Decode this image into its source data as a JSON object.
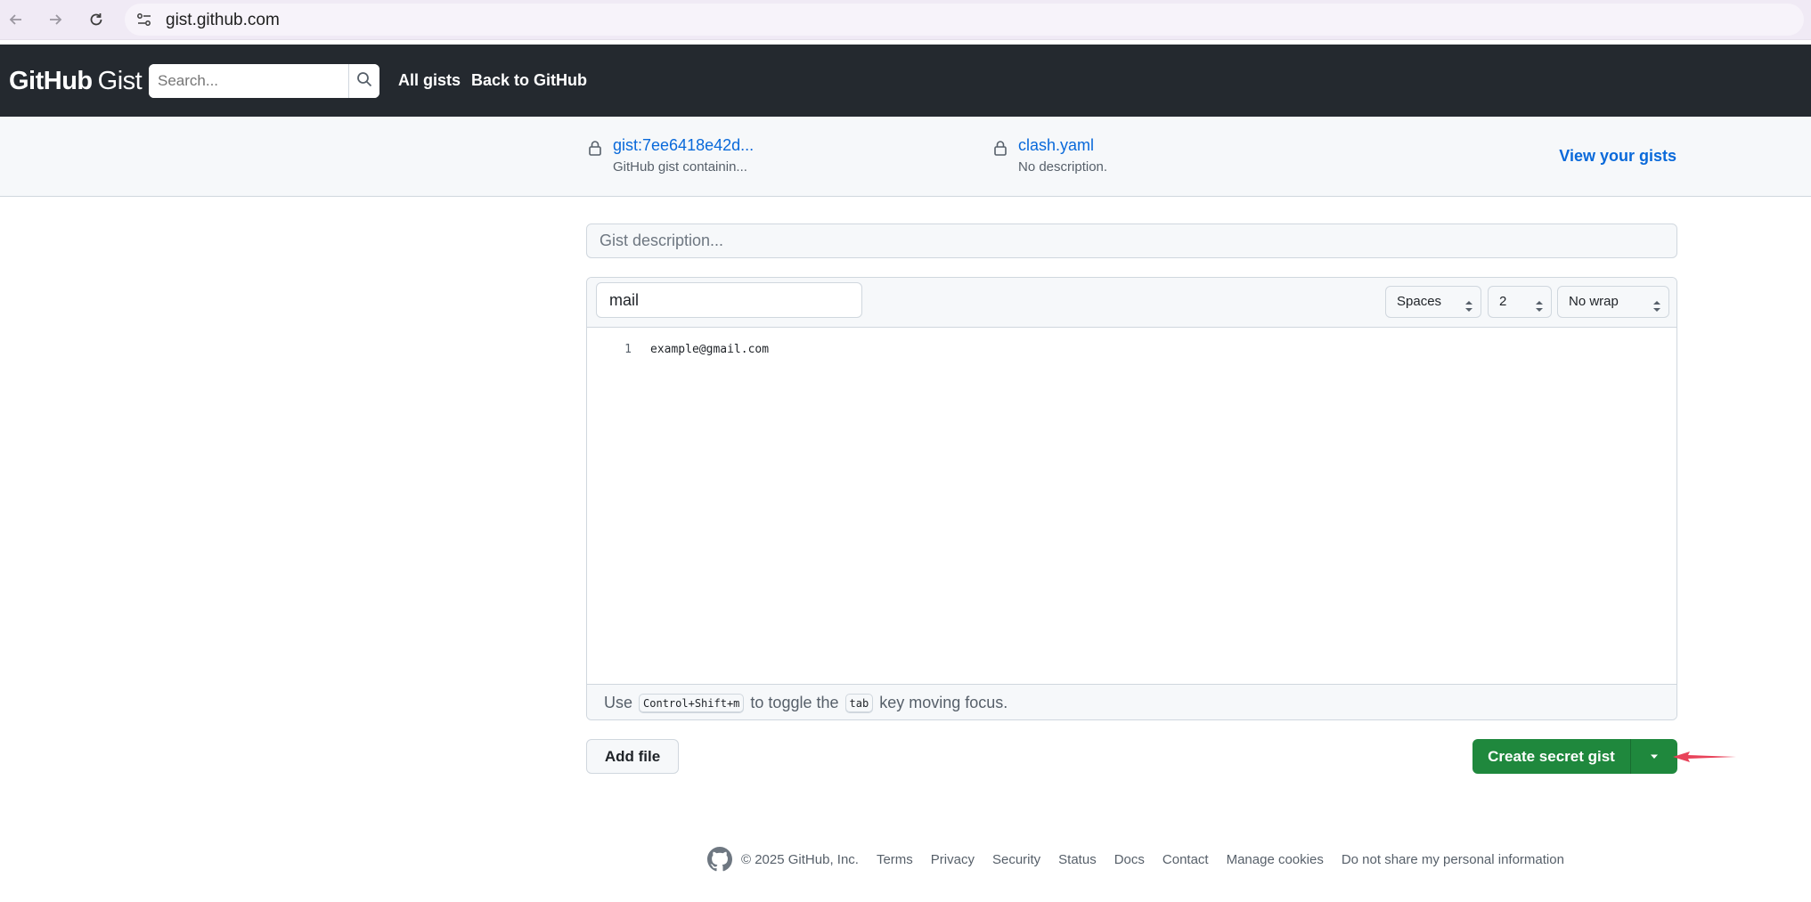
{
  "browser": {
    "url": "gist.github.com"
  },
  "header": {
    "logo_bold": "GitHub",
    "logo_light": "Gist",
    "search_placeholder": "Search...",
    "nav": [
      "All gists",
      "Back to GitHub"
    ]
  },
  "pinned": [
    {
      "title": "gist:7ee6418e42d...",
      "description": "GitHub gist containin..."
    },
    {
      "title": "clash.yaml",
      "description": "No description."
    }
  ],
  "view_gists": "View your gists",
  "form": {
    "description_placeholder": "Gist description...",
    "filename_value": "mail",
    "indent_mode": "Spaces",
    "indent_size": "2",
    "wrap_mode": "No wrap",
    "code_lines": [
      {
        "number": "1",
        "text": "example@gmail.com"
      }
    ],
    "hint_prefix": "Use",
    "hint_key1": "Control+Shift+m",
    "hint_middle": "to toggle the",
    "hint_key2": "tab",
    "hint_suffix": "key moving focus.",
    "add_file_label": "Add file",
    "create_label": "Create secret gist"
  },
  "footer": {
    "copyright": "© 2025 GitHub, Inc.",
    "links": [
      "Terms",
      "Privacy",
      "Security",
      "Status",
      "Docs",
      "Contact",
      "Manage cookies",
      "Do not share my personal information"
    ]
  },
  "colors": {
    "header_bg": "#24292f",
    "link": "#0969da",
    "primary_button": "#1f883d",
    "annotation_arrow": "#e8435a"
  },
  "icons": [
    "back-arrow-icon",
    "forward-arrow-icon",
    "reload-icon",
    "site-info-icon",
    "search-icon",
    "lock-icon",
    "caret-down-icon",
    "select-arrows-icon",
    "github-mark-icon"
  ]
}
